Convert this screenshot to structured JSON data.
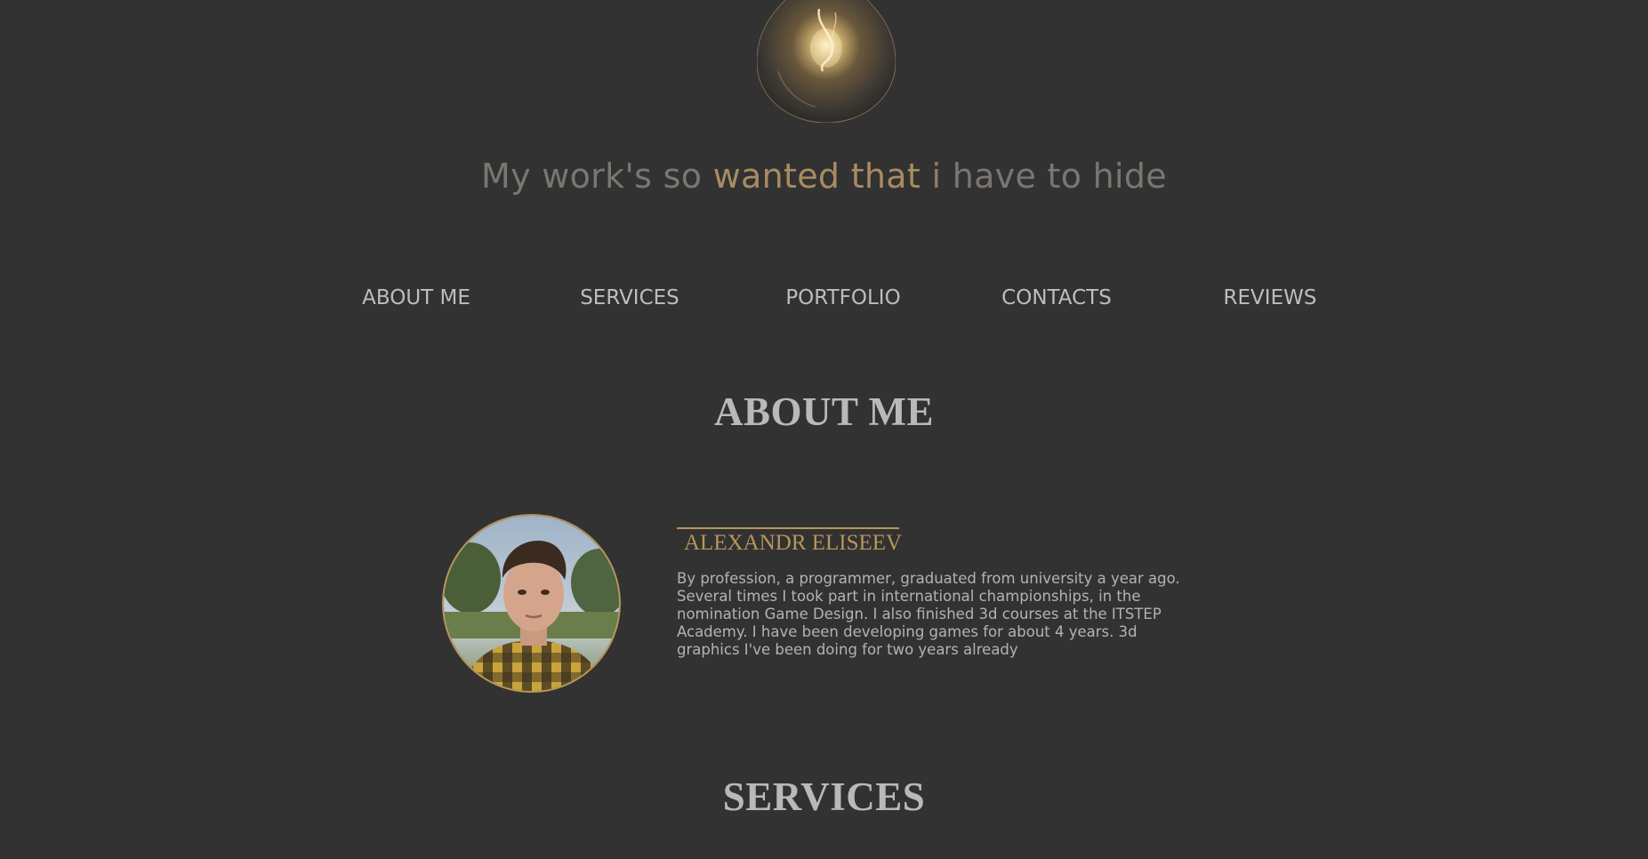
{
  "header": {
    "bulb_icon": "light-bulb-icon",
    "tagline": {
      "part1": "My work's so ",
      "part2": "wanted that",
      "part3": " i ",
      "part4": "have to hide"
    }
  },
  "nav": {
    "items": [
      {
        "label": "ABOUT ME"
      },
      {
        "label": "SERVICES"
      },
      {
        "label": "PORTFOLIO"
      },
      {
        "label": "CONTACTS"
      },
      {
        "label": "REVIEWS"
      }
    ]
  },
  "about": {
    "title": "ABOUT ME",
    "name": "ALEXANDR ELISEEV",
    "bio": "By profession, a programmer, graduated from university a year ago. Several times I took part in international championships, in the nomination Game Design. I also finished 3d courses at the ITSTEP Academy. I have been developing games for about 4 years. 3d graphics I've been doing for two years already"
  },
  "services": {
    "title": "SERVICES"
  },
  "colors": {
    "background": "#323232",
    "accent": "#b8955b",
    "text": "#b3b3b3",
    "heading": "#b9b9b9"
  }
}
